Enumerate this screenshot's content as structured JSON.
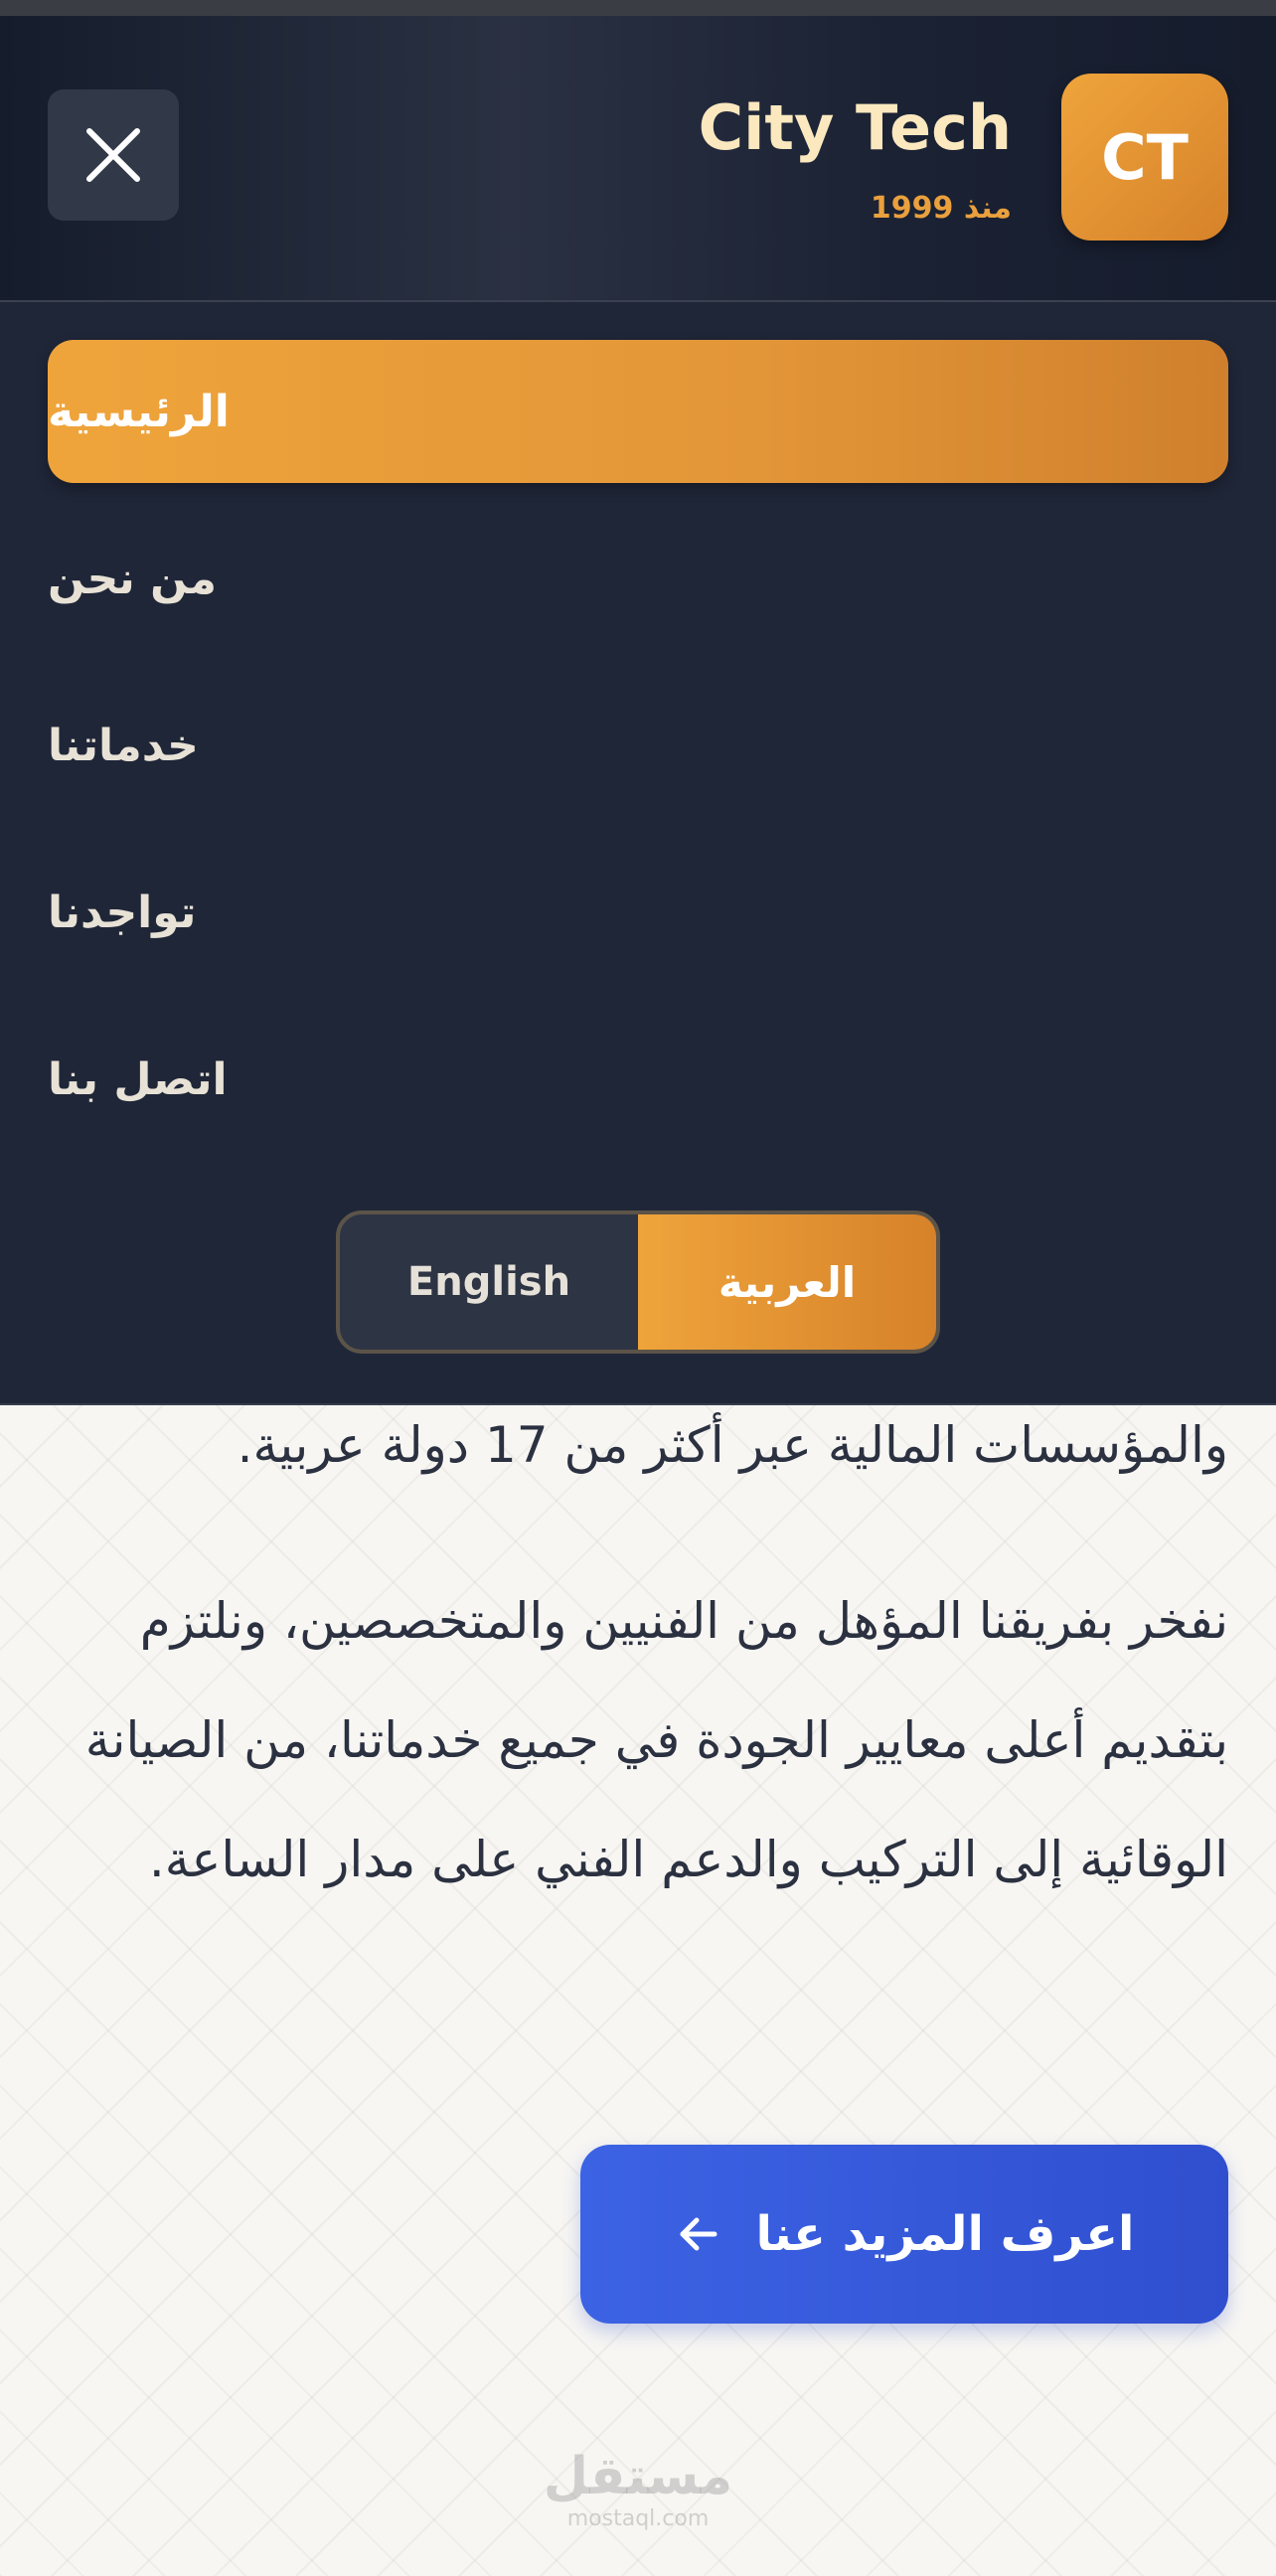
{
  "header": {
    "logo_text": "CT",
    "brand_name": "City Tech",
    "since": "منذ 1999",
    "close_icon": "close-icon"
  },
  "nav": {
    "items": [
      {
        "label": "الرئيسية",
        "active": true
      },
      {
        "label": "من نحن",
        "active": false
      },
      {
        "label": "خدماتنا",
        "active": false
      },
      {
        "label": "تواجدنا",
        "active": false
      },
      {
        "label": "اتصل بنا",
        "active": false
      }
    ]
  },
  "language": {
    "english": "English",
    "arabic": "العربية",
    "selected": "العربية"
  },
  "content": {
    "line_partial": "والمؤسسات المالية عبر أكثر من 17 دولة عربية.",
    "paragraph": "نفخر بفريقنا المؤهل من الفنيين والمتخصصين، ونلتزم بتقديم أعلى معايير الجودة في جميع خدماتنا، من الصيانة الوقائية إلى التركيب والدعم الفني على مدار الساعة.",
    "cta_label": "اعرف المزيد عنا",
    "cta_icon": "arrow-left-icon"
  },
  "watermark": {
    "arabic": "مستقل",
    "domain": "mostaql.com"
  },
  "colors": {
    "accent_orange": "#e99a37",
    "header_dark": "#1f2638",
    "cta_blue": "#3559dc"
  }
}
